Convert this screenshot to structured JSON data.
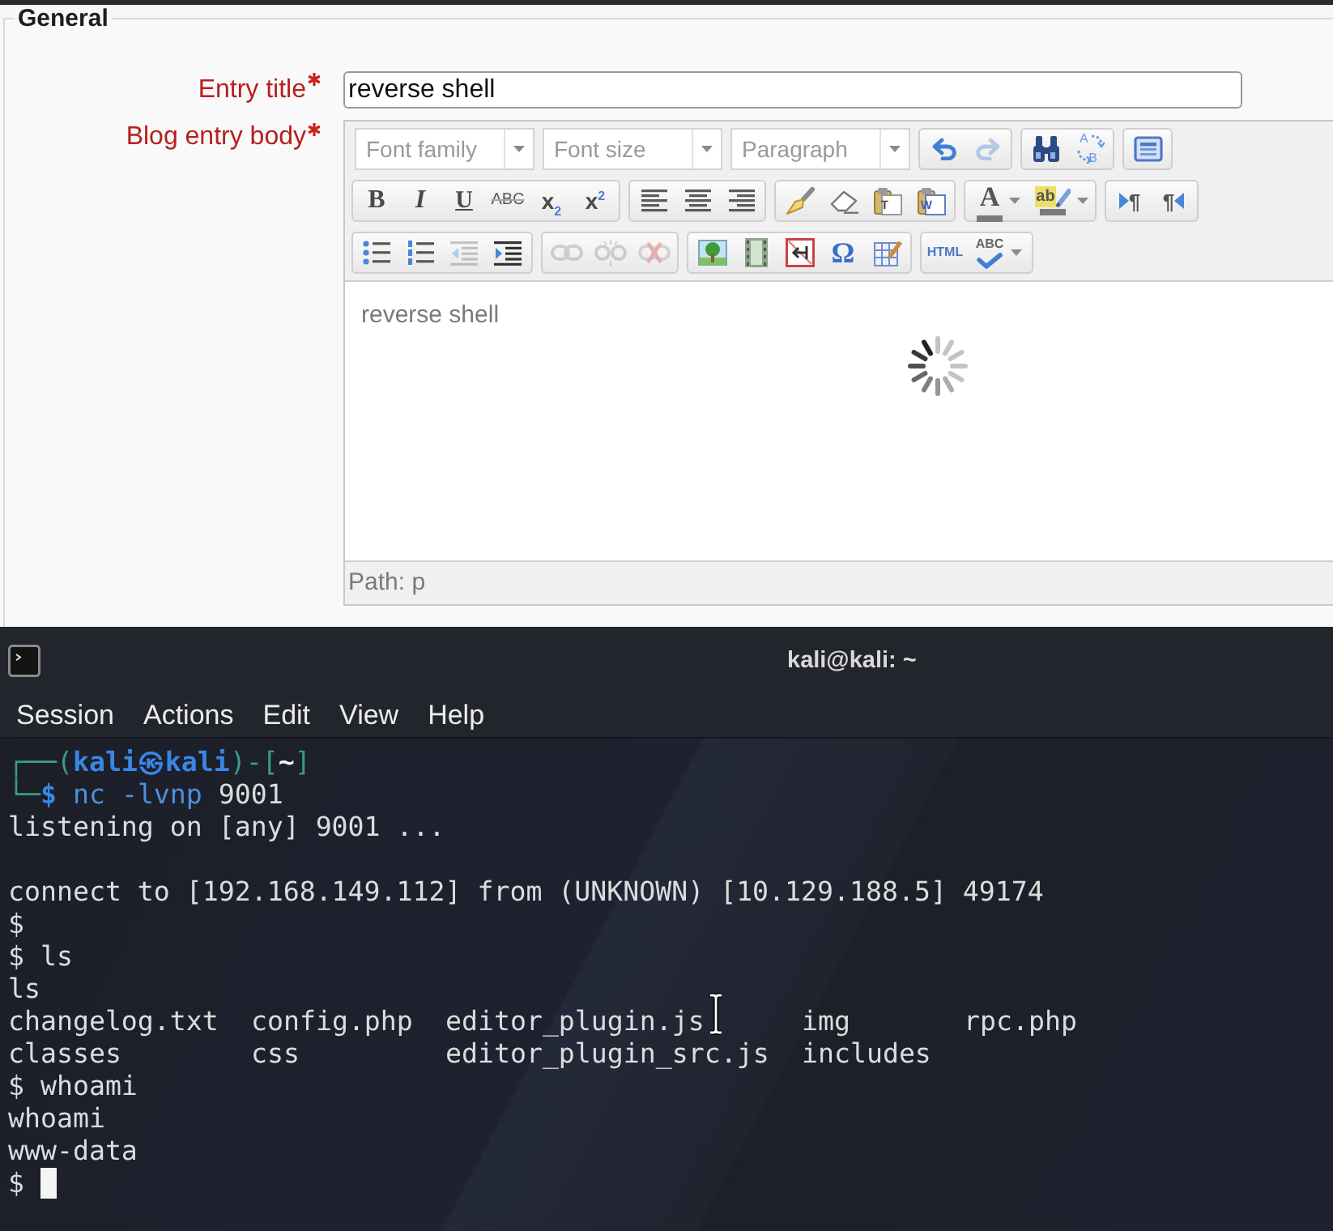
{
  "form": {
    "legend": "General",
    "fields": [
      {
        "kind": "text",
        "label": "Entry title",
        "required": true,
        "value": "reverse shell"
      },
      {
        "kind": "editor",
        "label": "Blog entry body",
        "required": true,
        "editor": {
          "toolbar": [
            [
              {
                "kind": "select",
                "text": "Font family"
              },
              {
                "kind": "select",
                "text": "Font size"
              },
              {
                "kind": "select",
                "text": "Paragraph"
              },
              {
                "kind": "group",
                "tools": [
                  {
                    "kind": "undo",
                    "disabled": false
                  },
                  {
                    "kind": "redo",
                    "disabled": true
                  }
                ]
              },
              {
                "kind": "group",
                "tools": [
                  {
                    "kind": "find",
                    "disabled": false
                  },
                  {
                    "kind": "replace",
                    "labels": [
                      "A",
                      "B"
                    ],
                    "disabled": false
                  }
                ]
              },
              {
                "kind": "group",
                "tools": [
                  {
                    "kind": "fullscreen",
                    "disabled": false
                  }
                ]
              }
            ],
            [
              {
                "kind": "group",
                "tools": [
                  {
                    "kind": "bold",
                    "label": "B",
                    "disabled": false
                  },
                  {
                    "kind": "italic",
                    "label": "I",
                    "disabled": false
                  },
                  {
                    "kind": "underline",
                    "label": "U",
                    "disabled": false
                  },
                  {
                    "kind": "strikethrough",
                    "label": "ABC",
                    "disabled": false
                  },
                  {
                    "kind": "subscript",
                    "label": "x$_{2}$",
                    "disabled": false
                  },
                  {
                    "kind": "superscript",
                    "label": "x$^{2}$",
                    "disabled": false
                  }
                ]
              },
              {
                "kind": "group",
                "tools": [
                  {
                    "kind": "align_left",
                    "disabled": false
                  },
                  {
                    "kind": "align_center",
                    "disabled": false
                  },
                  {
                    "kind": "align_right",
                    "disabled": false
                  }
                ]
              },
              {
                "kind": "group",
                "tools": [
                  {
                    "kind": "format_painter",
                    "disabled": false
                  },
                  {
                    "kind": "eraser",
                    "disabled": false
                  },
                  {
                    "kind": "paste_text",
                    "label": "T",
                    "disabled": false
                  },
                  {
                    "kind": "paste_word",
                    "label": "W",
                    "disabled": false
                  }
                ]
              },
              {
                "kind": "group",
                "tools": [
                  {
                    "kind": "font_color",
                    "label": "A",
                    "menu": true,
                    "disabled": false
                  },
                  {
                    "kind": "highlight",
                    "label": "ab",
                    "menu": true,
                    "disabled": false
                  }
                ]
              },
              {
                "kind": "group",
                "tools": [
                  {
                    "kind": "ltr",
                    "label": "¶",
                    "disabled": false
                  },
                  {
                    "kind": "rtl",
                    "label": "¶",
                    "disabled": false
                  }
                ]
              }
            ],
            [
              {
                "kind": "group",
                "tools": [
                  {
                    "kind": "bullet_list",
                    "disabled": false
                  },
                  {
                    "kind": "numbered_list",
                    "disabled": false
                  },
                  {
                    "kind": "outdent",
                    "disabled": true
                  },
                  {
                    "kind": "indent",
                    "disabled": false
                  }
                ]
              },
              {
                "kind": "group",
                "tools": [
                  {
                    "kind": "link",
                    "disabled": true
                  },
                  {
                    "kind": "unlink",
                    "disabled": true
                  },
                  {
                    "kind": "nolink",
                    "disabled": true
                  }
                ]
              },
              {
                "kind": "group",
                "tools": [
                  {
                    "kind": "image",
                    "disabled": false
                  },
                  {
                    "kind": "media",
                    "disabled": false
                  },
                  {
                    "kind": "page_break",
                    "disabled": false
                  },
                  {
                    "kind": "special_char",
                    "label": "Ω",
                    "disabled": false
                  },
                  {
                    "kind": "table",
                    "disabled": false
                  }
                ]
              },
              {
                "kind": "group",
                "tools": [
                  {
                    "kind": "html",
                    "label": "HTML",
                    "disabled": false
                  },
                  {
                    "kind": "spellcheck",
                    "label": "ABC",
                    "menu": true,
                    "disabled": false
                  }
                ]
              }
            ]
          ],
          "body": "reverse shell",
          "loading": true,
          "path": "Path: p"
        }
      }
    ]
  },
  "terminal": {
    "title": "kali@kali: ~",
    "menu": [
      "Session",
      "Actions",
      "Edit",
      "View",
      "Help"
    ],
    "lines": [
      {
        "kind": "prompt",
        "open": "┌──(",
        "user": "kali㉿kali",
        "middle": ")-[",
        "dir": "~",
        "close": "]"
      },
      {
        "kind": "command",
        "corner": "└─",
        "sign": "$",
        "command": "nc -lvnp",
        "argument": "9001"
      },
      {
        "kind": "output",
        "text": "listening on [any] 9001 ..."
      },
      {
        "kind": "blank"
      },
      {
        "kind": "output",
        "text": "connect to [192.168.149.112] from (UNKNOWN) [10.129.188.5] 49174"
      },
      {
        "kind": "output",
        "text": "$"
      },
      {
        "kind": "output",
        "text": "$ ls"
      },
      {
        "kind": "output",
        "text": "ls"
      },
      {
        "kind": "listing",
        "files": [
          "changelog.txt",
          "config.php",
          "editor_plugin.js",
          "img",
          "rpc.php"
        ]
      },
      {
        "kind": "listing",
        "files": [
          "classes",
          "css",
          "editor_plugin_src.js",
          "includes"
        ]
      },
      {
        "kind": "output",
        "text": "$ whoami"
      },
      {
        "kind": "output",
        "text": "whoami"
      },
      {
        "kind": "output",
        "text": "www-data"
      },
      {
        "kind": "input",
        "text": "$",
        "cursor": true
      }
    ]
  }
}
